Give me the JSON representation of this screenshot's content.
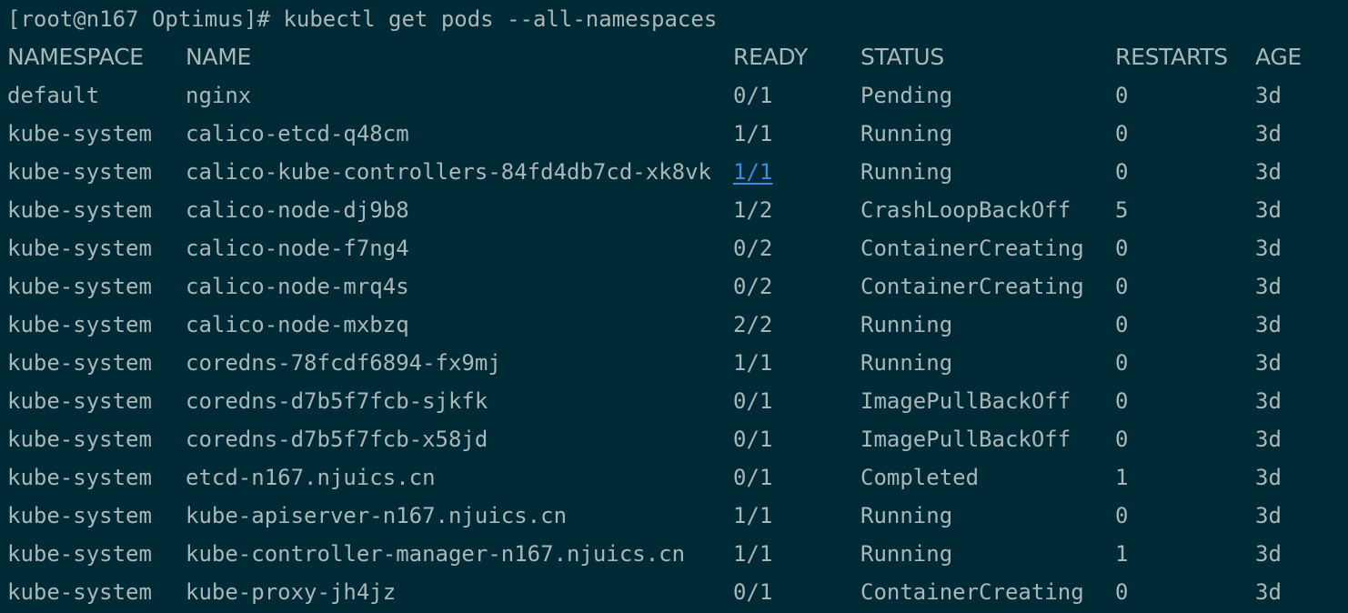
{
  "terminal": {
    "prompt": "[root@n167 Optimus]# ",
    "command": "kubectl get pods --all-namespaces",
    "colors": {
      "background": "#002b36",
      "text": "#a9b7b9",
      "link": "#3d8be0"
    }
  },
  "table": {
    "headers": {
      "namespace": "NAMESPACE",
      "name": "NAME",
      "ready": "READY",
      "status": "STATUS",
      "restarts": "RESTARTS",
      "age": "AGE"
    },
    "rows": [
      {
        "namespace": "default",
        "name": "nginx",
        "ready": "0/1",
        "status": "Pending",
        "restarts": "0",
        "age": "3d"
      },
      {
        "namespace": "kube-system",
        "name": "calico-etcd-q48cm",
        "ready": "1/1",
        "status": "Running",
        "restarts": "0",
        "age": "3d"
      },
      {
        "namespace": "kube-system",
        "name": "calico-kube-controllers-84fd4db7cd-xk8vk",
        "ready": "1/1",
        "status": "Running",
        "restarts": "0",
        "age": "3d"
      },
      {
        "namespace": "kube-system",
        "name": "calico-node-dj9b8",
        "ready": "1/2",
        "status": "CrashLoopBackOff",
        "restarts": "5",
        "age": "3d"
      },
      {
        "namespace": "kube-system",
        "name": "calico-node-f7ng4",
        "ready": "0/2",
        "status": "ContainerCreating",
        "restarts": "0",
        "age": "3d"
      },
      {
        "namespace": "kube-system",
        "name": "calico-node-mrq4s",
        "ready": "0/2",
        "status": "ContainerCreating",
        "restarts": "0",
        "age": "3d"
      },
      {
        "namespace": "kube-system",
        "name": "calico-node-mxbzq",
        "ready": "2/2",
        "status": "Running",
        "restarts": "0",
        "age": "3d"
      },
      {
        "namespace": "kube-system",
        "name": "coredns-78fcdf6894-fx9mj",
        "ready": "1/1",
        "status": "Running",
        "restarts": "0",
        "age": "3d"
      },
      {
        "namespace": "kube-system",
        "name": "coredns-d7b5f7fcb-sjkfk",
        "ready": "0/1",
        "status": "ImagePullBackOff",
        "restarts": "0",
        "age": "3d"
      },
      {
        "namespace": "kube-system",
        "name": "coredns-d7b5f7fcb-x58jd",
        "ready": "0/1",
        "status": "ImagePullBackOff",
        "restarts": "0",
        "age": "3d"
      },
      {
        "namespace": "kube-system",
        "name": "etcd-n167.njuics.cn",
        "ready": "0/1",
        "status": "Completed",
        "restarts": "1",
        "age": "3d"
      },
      {
        "namespace": "kube-system",
        "name": "kube-apiserver-n167.njuics.cn",
        "ready": "1/1",
        "status": "Running",
        "restarts": "0",
        "age": "3d"
      },
      {
        "namespace": "kube-system",
        "name": "kube-controller-manager-n167.njuics.cn",
        "ready": "1/1",
        "status": "Running",
        "restarts": "1",
        "age": "3d"
      },
      {
        "namespace": "kube-system",
        "name": "kube-proxy-jh4jz",
        "ready": "0/1",
        "status": "ContainerCreating",
        "restarts": "0",
        "age": "3d"
      }
    ]
  }
}
